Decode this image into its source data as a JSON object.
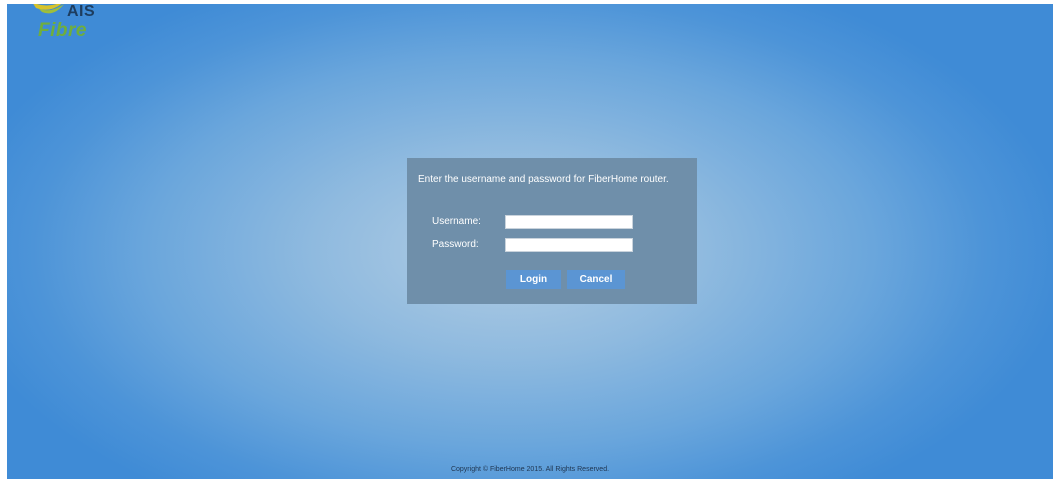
{
  "logo": {
    "brand_top": "AIS",
    "brand_bottom": "Fibre",
    "colors": {
      "ais": "#1d3d5f",
      "fibre": "#6fae3c",
      "swoosh": "#d7c32a"
    }
  },
  "login": {
    "prompt": "Enter the username and password for FiberHome router.",
    "username_label": "Username:",
    "username_value": "",
    "password_label": "Password:",
    "password_value": "",
    "login_button": "Login",
    "cancel_button": "Cancel"
  },
  "footer": {
    "copyright": "Copyright © FiberHome 2015. All Rights Reserved."
  }
}
